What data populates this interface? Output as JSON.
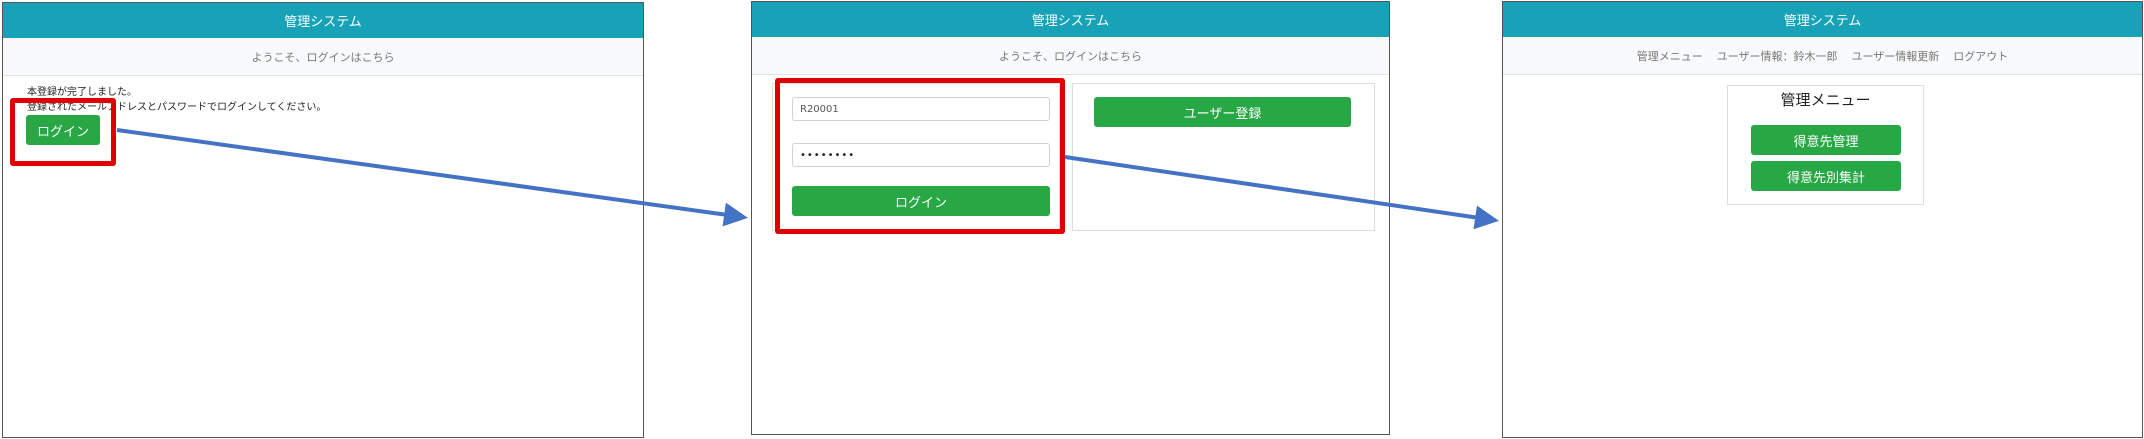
{
  "panel1": {
    "header_title": "管理システム",
    "subheader": "ようこそ、ログインはこちら",
    "message_line1": "本登録が完了しました。",
    "message_line2": "登録されたメールアドレスとパスワードでログインしてください。",
    "login_button": "ログイン"
  },
  "panel2": {
    "header_title": "管理システム",
    "subheader": "ようこそ、ログインはこちら",
    "userid_value": "R20001",
    "password_value": "••••••••",
    "login_button": "ログイン",
    "register_button": "ユーザー登録"
  },
  "panel3": {
    "header_title": "管理システム",
    "nav": [
      "管理メニュー",
      "ユーザー情報：鈴木一郎",
      "ユーザー情報更新",
      "ログアウト"
    ],
    "menu_title": "管理メニュー",
    "menu_buttons": [
      "得意先管理",
      "得意先別集計"
    ]
  },
  "colors": {
    "header": "#17a2b8",
    "button": "#28a745",
    "highlight": "#e00000",
    "arrow": "#4472c4"
  }
}
